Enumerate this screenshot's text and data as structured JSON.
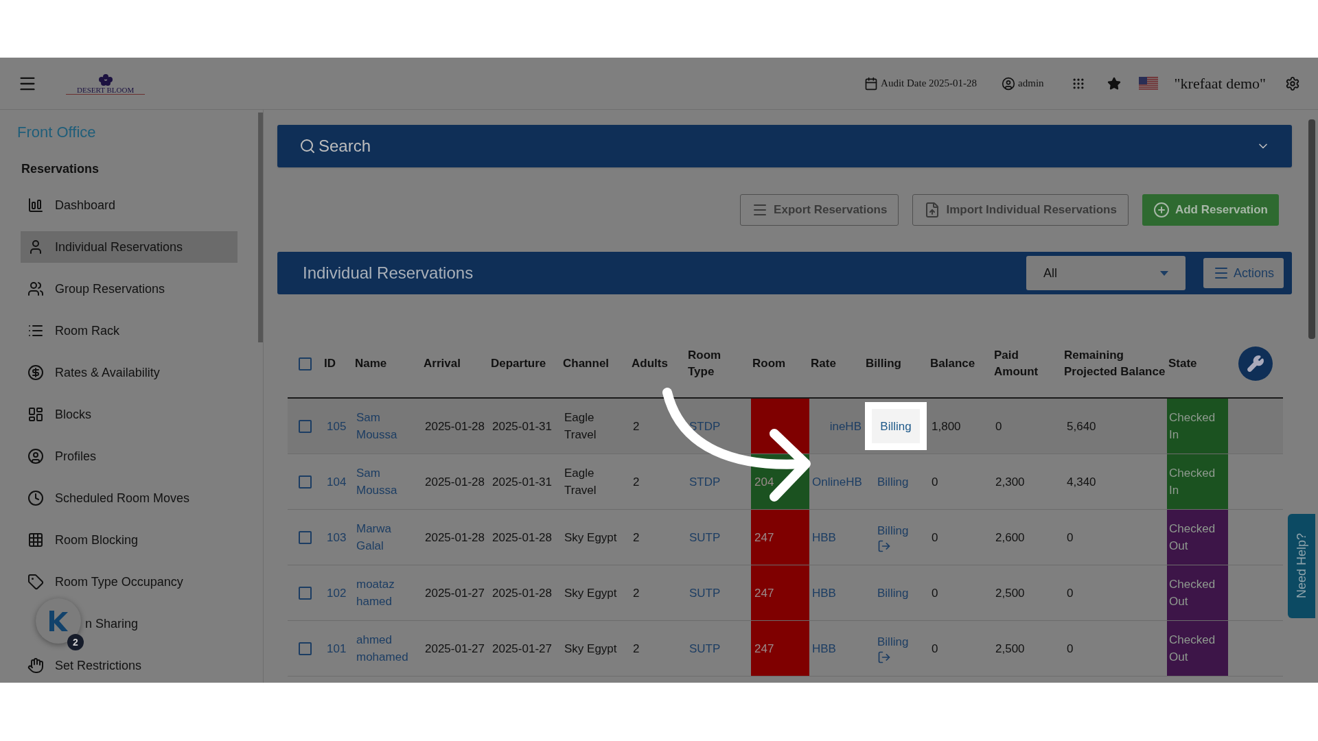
{
  "header": {
    "logo_text": "DESERT BLOOM",
    "audit_label": "Audit Date 2025-01-28",
    "user": "admin",
    "workspace": "\"krefaat demo\""
  },
  "sidebar": {
    "section_title": "Front Office",
    "group_title": "Reservations",
    "items": [
      {
        "label": "Dashboard",
        "selected": false
      },
      {
        "label": "Individual Reservations",
        "selected": true
      },
      {
        "label": "Group Reservations",
        "selected": false
      },
      {
        "label": "Room Rack",
        "selected": false
      },
      {
        "label": "Rates & Availability",
        "selected": false
      },
      {
        "label": "Blocks",
        "selected": false
      },
      {
        "label": "Profiles",
        "selected": false
      },
      {
        "label": "Scheduled Room Moves",
        "selected": false
      },
      {
        "label": "Room Blocking",
        "selected": false
      },
      {
        "label": "Room Type Occupancy",
        "selected": false
      },
      {
        "label": "n Sharing",
        "selected": false
      },
      {
        "label": "Set Restrictions",
        "selected": false
      }
    ],
    "widget_badge": "2"
  },
  "search": {
    "label": "Search"
  },
  "toolbar": {
    "buttons": [
      {
        "label": "Export Reservations",
        "kind": "export"
      },
      {
        "label": "Import Individual Reservations",
        "kind": "import"
      },
      {
        "label": "Add Reservation",
        "kind": "add"
      }
    ]
  },
  "panel": {
    "title": "Individual Reservations",
    "filter": "All",
    "actions": "Actions"
  },
  "table": {
    "select_all_checked": false,
    "columns": [
      "ID",
      "Name",
      "Arrival",
      "Departure",
      "Channel",
      "Adults",
      "Room Type",
      "Room",
      "Rate",
      "Billing",
      "Balance",
      "Paid Amount",
      "Remaining Projected Balance",
      "State"
    ],
    "rows": [
      {
        "checked": false,
        "id": "105",
        "name": "Sam Moussa",
        "arrival": "2025-01-28",
        "departure": "2025-01-31",
        "channel": "Eagle Travel",
        "adults": "2",
        "room_type": "STDP",
        "room": {
          "color": "#7f0000"
        },
        "rate": "ineHB",
        "billing": "Billing",
        "spotlight": true,
        "checkout_link": false,
        "balance": "1,800",
        "paid": "0",
        "remaining": "5,640",
        "state": {
          "text": "Checked In",
          "color": "#1b5220"
        }
      },
      {
        "checked": false,
        "id": "104",
        "name": "Sam Moussa",
        "arrival": "2025-01-28",
        "departure": "2025-01-31",
        "channel": "Eagle Travel",
        "adults": "2",
        "room_type": "STDP",
        "room": {
          "text": "204",
          "color": "#1b5220"
        },
        "rate": "OnlineHB",
        "billing": "Billing",
        "spotlight": false,
        "checkout_link": false,
        "balance": "0",
        "paid": "2,300",
        "remaining": "4,340",
        "state": {
          "text": "Checked In",
          "color": "#1b5220"
        }
      },
      {
        "checked": false,
        "id": "103",
        "name": "Marwa Galal",
        "arrival": "2025-01-28",
        "departure": "2025-01-28",
        "channel": "Sky Egypt",
        "adults": "2",
        "room_type": "SUTP",
        "room": {
          "text": "247",
          "color": "#7f0000"
        },
        "rate": "HBB",
        "billing": "Billing",
        "spotlight": false,
        "checkout_link": true,
        "balance": "0",
        "paid": "2,600",
        "remaining": "0",
        "state": {
          "text": "Checked Out",
          "color": "#3d1548"
        }
      },
      {
        "checked": false,
        "id": "102",
        "name": "moataz hamed",
        "arrival": "2025-01-27",
        "departure": "2025-01-28",
        "channel": "Sky Egypt",
        "adults": "2",
        "room_type": "SUTP",
        "room": {
          "text": "247",
          "color": "#7f0000"
        },
        "rate": "HBB",
        "billing": "Billing",
        "spotlight": false,
        "checkout_link": false,
        "balance": "0",
        "paid": "2,500",
        "remaining": "0",
        "state": {
          "text": "Checked Out",
          "color": "#3d1548"
        }
      },
      {
        "checked": false,
        "id": "101",
        "name": "ahmed mohamed",
        "arrival": "2025-01-27",
        "departure": "2025-01-27",
        "channel": "Sky Egypt",
        "adults": "2",
        "room_type": "SUTP",
        "room": {
          "text": "247",
          "color": "#7f0000"
        },
        "rate": "HBB",
        "billing": "Billing",
        "spotlight": false,
        "checkout_link": true,
        "balance": "0",
        "paid": "2,500",
        "remaining": "0",
        "state": {
          "text": "Checked Out",
          "color": "#3d1548"
        }
      }
    ]
  },
  "help_tab": "Need Help?"
}
